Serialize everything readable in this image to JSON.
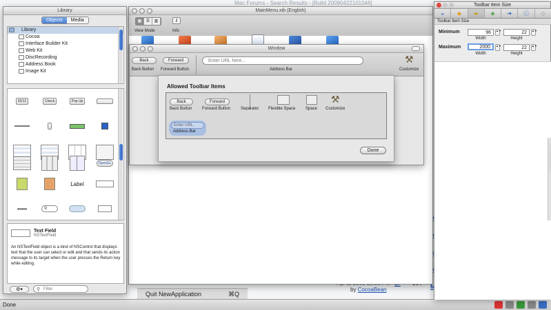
{
  "background": {
    "title": "Mac Forums - Search Results - [Build 20090422101046]",
    "date_fragment": "Apr 1, 2009 10:50 PM",
    "by_label": "by",
    "author": "CocoaBean",
    "replies": "17",
    "views": "364",
    "m_link": "M",
    "menu": {
      "quit": "Quit NewApplication",
      "shortcut": "⌘Q"
    }
  },
  "status": {
    "text": "Done"
  },
  "library": {
    "title": "Library",
    "tabs": [
      "Objects",
      "Media"
    ],
    "tree": [
      "Library",
      "Cocoa",
      "Interface Builder Kit",
      "Web Kit",
      "DiscRecording",
      "Address Book",
      "Image Kit"
    ],
    "grid_labels": {
      "date": "02/12",
      "check": "Check",
      "popup": "Pop Up",
      "label": "Label",
      "opengl": "OpenGL",
      "secure": "•••••"
    },
    "info": {
      "name": "Text Field",
      "class": "NSTextField",
      "description": "An NSTextField object is a kind of NSControl that displays text that the user can select or edit and that sends its action message to its target when the user presses the Return key while editing."
    },
    "filter_placeholder": "Filter"
  },
  "xib": {
    "title": "MainMenu.xib (English)",
    "view_mode_label": "View Mode",
    "info_label": "Info",
    "info_glyph": "i"
  },
  "demo": {
    "title": "Window",
    "back": "Back",
    "forward": "Forward",
    "back_label": "Back Button",
    "forward_label": "Forward Button",
    "url_placeholder": "Enter URL here...",
    "address_label": "Address Bar",
    "customize_label": "Customize"
  },
  "sheet": {
    "title": "Allowed Toolbar Items",
    "items": {
      "back": "Back",
      "back_label": "Back Button",
      "forward": "Forward",
      "forward_label": "Forward Button",
      "separator": "Separator",
      "flexible": "Flexible Space",
      "space": "Space",
      "customize": "Customize",
      "url": "Enter URL",
      "address": "Address Bar"
    },
    "done": "Done"
  },
  "inspector": {
    "title": "Toolbar Item Size",
    "section": "Toolbar Item Size",
    "minimum": "Minimum",
    "maximum": "Maximum",
    "min_width": "96",
    "min_height": "22",
    "max_width": "2000",
    "max_height": "22",
    "width_label": "Width",
    "height_label": "Height"
  },
  "colors": {
    "accent": "#4b80d0",
    "link": "#1e4fb5"
  }
}
